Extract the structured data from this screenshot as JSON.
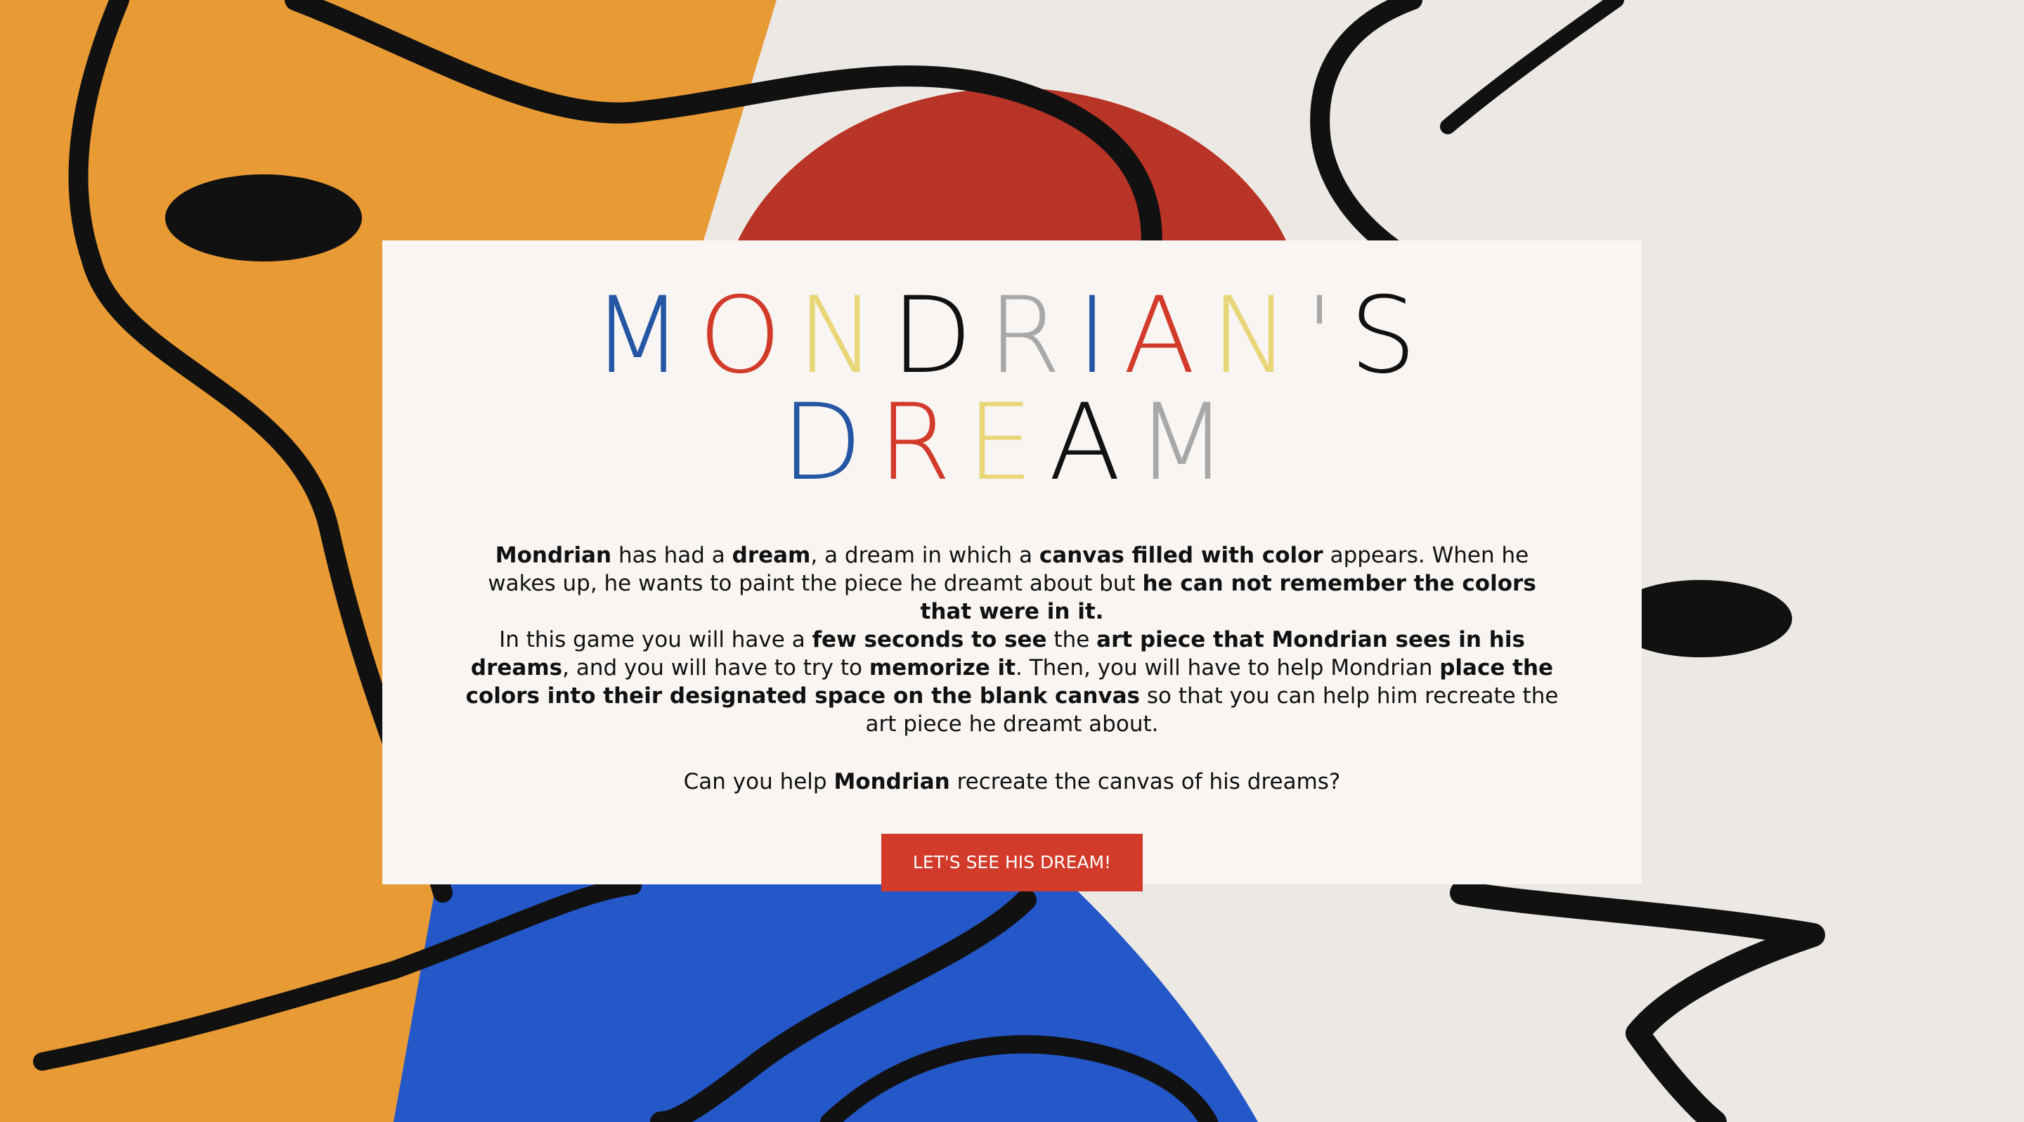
{
  "colors": {
    "blue": "#2456a4",
    "red": "#d23a2a",
    "yellow": "#e8d678",
    "black": "#111111",
    "gray": "#a8a8a8",
    "card": "#f8f5f2",
    "background_orange": "#e89a35",
    "background_cream": "#ece9e5",
    "background_blue": "#2458c8",
    "background_red_circle": "#b83426",
    "button": "#d23a2a"
  },
  "title": {
    "line1": [
      {
        "ch": "M",
        "color": "#2456a4"
      },
      {
        "ch": "O",
        "color": "#d23a2a"
      },
      {
        "ch": "N",
        "color": "#e8d678"
      },
      {
        "ch": "D",
        "color": "#111111"
      },
      {
        "ch": "R",
        "color": "#a8a8a8"
      },
      {
        "ch": "I",
        "color": "#2456a4"
      },
      {
        "ch": "A",
        "color": "#d23a2a"
      },
      {
        "ch": "N",
        "color": "#e8d678"
      },
      {
        "ch": "'",
        "color": "#a8a8a8"
      },
      {
        "ch": "S",
        "color": "#111111"
      }
    ],
    "line2": [
      {
        "ch": "D",
        "color": "#2456a4"
      },
      {
        "ch": "R",
        "color": "#d23a2a"
      },
      {
        "ch": "E",
        "color": "#e8d678"
      },
      {
        "ch": "A",
        "color": "#111111"
      },
      {
        "ch": "M",
        "color": "#a8a8a8"
      }
    ]
  },
  "intro": {
    "p1_a": "Mondrian",
    "p1_b": " has had a ",
    "p1_c": "dream",
    "p1_d": ", a dream in which a ",
    "p1_e": "canvas filled with color",
    "p1_f": " appears. When he wakes up, he wants to paint the piece he dreamt about but ",
    "p1_g": "he can not remember the colors that were in it.",
    "p2_a": "In this game you will have a ",
    "p2_b": "few seconds to see",
    "p2_c": " the ",
    "p2_d": "art piece that Mondrian sees in his dreams",
    "p2_e": ", and you will have to try to ",
    "p2_f": "memorize it",
    "p2_g": ". Then, you will have to help Mondrian ",
    "p2_h": "place the colors into their designated space on the blank canvas",
    "p2_i": " so that you can help him recreate the art piece he dreamt about."
  },
  "question": {
    "a": "Can you help ",
    "b": "Mondrian",
    "c": " recreate the canvas of his dreams?"
  },
  "start_button_label": "LET'S SEE HIS DREAM!"
}
